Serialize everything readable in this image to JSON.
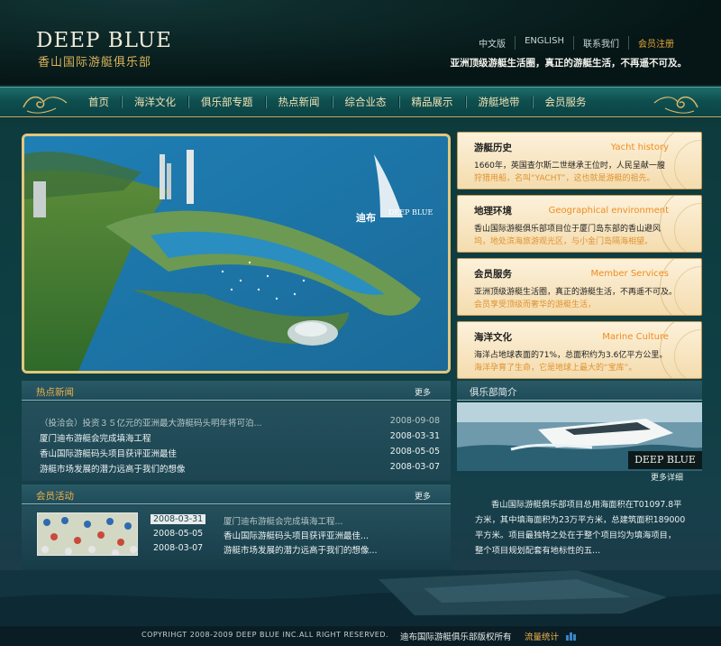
{
  "header": {
    "logo_en": "DEEP BLUE",
    "logo_cn": "香山国际游艇俱乐部",
    "links": [
      "中文版",
      "ENGLISH",
      "联系我们",
      "会员注册"
    ],
    "slogan": "亚洲顶级游艇生活圈，真正的游艇生活，不再遥不可及。"
  },
  "nav": {
    "items": [
      "首页",
      "海洋文化",
      "俱乐部专题",
      "热点新闻",
      "综合业态",
      "精品展示",
      "游艇地带",
      "会员服务"
    ]
  },
  "hero": {
    "brand_cn": "迪布",
    "brand_en": "DEEP BLUE"
  },
  "cards": [
    {
      "cn": "游艇历史",
      "en": "Yacht history",
      "l1": "1660年，英国查尔斯二世继承王位时，人民呈献一艘",
      "l2": "狩猎用船，名叫“YACHT”，这也就是游艇的祖先。"
    },
    {
      "cn": "地理环境",
      "en": "Geographical environment",
      "l1": "香山国际游艇俱乐部项目位于厦门岛东部的香山避风",
      "l2": "坞，地处滨海旅游观光区，与小金门岛隔海相望。"
    },
    {
      "cn": "会员服务",
      "en": "Member Services",
      "l1": "亚洲顶级游艇生活圈，真正的游艇生活，不再遥不可及。",
      "l2": "会员享受顶级而奢华的游艇生活，"
    },
    {
      "cn": "海洋文化",
      "en": "Marine Culture",
      "l1": "海洋占地球表面的71%，总面积约为3.6亿平方公里。",
      "l2": "海洋孕育了生命，它是地球上最大的“宝库”。"
    }
  ],
  "news": {
    "title": "热点新闻",
    "more": "更多",
    "items": [
      {
        "text": "（投洽会）投资３５亿元的亚洲最大游艇码头明年将可泊...",
        "date": "2008-09-08"
      },
      {
        "text": "厦门迪布游艇会完成填海工程",
        "date": "2008-03-31"
      },
      {
        "text": "香山国际游艇码头项目获评亚洲最佳",
        "date": "2008-05-05"
      },
      {
        "text": "游艇市场发展的潜力远高于我们的想像",
        "date": "2008-03-07"
      }
    ]
  },
  "activities": {
    "title": "会员活动",
    "more": "更多",
    "items": [
      {
        "date": "2008-03-31",
        "text": "厦门迪布游艇会完成填海工程..."
      },
      {
        "date": "2008-05-05",
        "text": "香山国际游艇码头项目获评亚洲最佳..."
      },
      {
        "date": "2008-03-07",
        "text": "游艇市场发展的潜力远高于我们的想像..."
      }
    ]
  },
  "intro": {
    "title": "俱乐部简介",
    "tag": "DEEP BLUE",
    "more": "更多详细",
    "lines": [
      "香山国际游艇俱乐部项目总用海面积在T01097.8平",
      "方米，其中填海面积为23万平方米，总建筑面积189000",
      "平方米。项目最独特之处在于整个项目均为填海项目，",
      "整个项目规划配套有地标性的五..."
    ]
  },
  "footer": {
    "copyright": "COPYRIHGT 2008-2009 DEEP BLUE INC.ALL RIGHT RESERVED.",
    "owner": "迪布国际游艇俱乐部版权所有",
    "stat": "流量统计"
  },
  "colors": {
    "accent_gold": "#d8b45a",
    "accent_orange": "#ef8c1e",
    "nav_bg": "#0f4f50"
  }
}
